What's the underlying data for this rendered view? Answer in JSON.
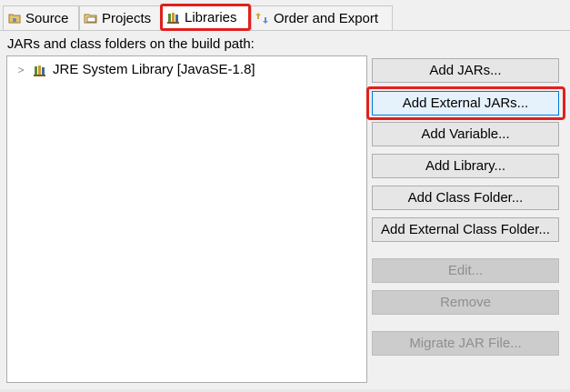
{
  "tabs": [
    {
      "label": "Source",
      "icon": "source-folder-icon"
    },
    {
      "label": "Projects",
      "icon": "projects-icon"
    },
    {
      "label": "Libraries",
      "icon": "libraries-icon",
      "active": true
    },
    {
      "label": "Order and Export",
      "icon": "order-export-icon"
    }
  ],
  "section_label": "JARs and class folders on the build path:",
  "tree": {
    "items": [
      {
        "label": "JRE System Library [JavaSE-1.8]",
        "icon": "library-icon",
        "expandable": true
      }
    ]
  },
  "buttons": {
    "add_jars": "Add JARs...",
    "add_external_jars": "Add External JARs...",
    "add_variable": "Add Variable...",
    "add_library": "Add Library...",
    "add_class_folder": "Add Class Folder...",
    "add_external_class_folder": "Add External Class Folder...",
    "edit": "Edit...",
    "remove": "Remove",
    "migrate_jar_file": "Migrate JAR File..."
  },
  "colors": {
    "highlight_red": "#e0201d",
    "focus_blue": "#0078d7"
  }
}
